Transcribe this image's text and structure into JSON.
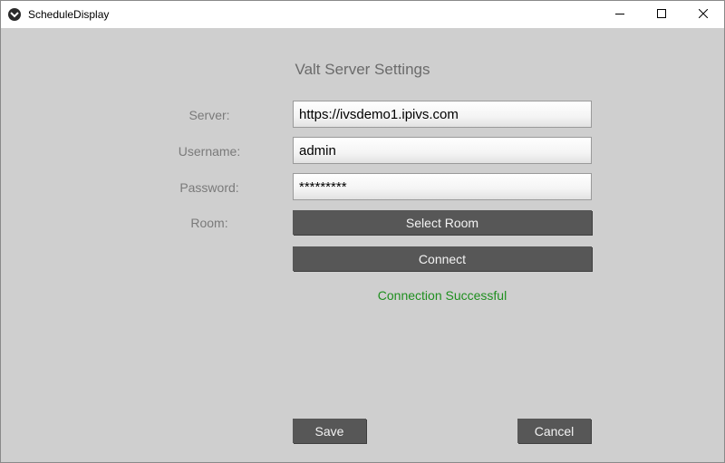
{
  "window": {
    "title": "ScheduleDisplay",
    "icons": {
      "app": "app-logo-icon",
      "minimize": "minimize-icon",
      "maximize": "maximize-icon",
      "close": "close-icon"
    }
  },
  "form": {
    "heading": "Valt Server Settings",
    "server": {
      "label": "Server:",
      "value": "https://ivsdemo1.ipivs.com"
    },
    "username": {
      "label": "Username:",
      "value": "admin"
    },
    "password": {
      "label": "Password:",
      "value": "*********"
    },
    "room": {
      "label": "Room:",
      "button_label": "Select Room"
    },
    "connect_label": "Connect",
    "status": "Connection Successful",
    "save_label": "Save",
    "cancel_label": "Cancel"
  },
  "colors": {
    "background": "#cfcfcf",
    "button": "#575757",
    "status_text": "#1f8f1f"
  }
}
